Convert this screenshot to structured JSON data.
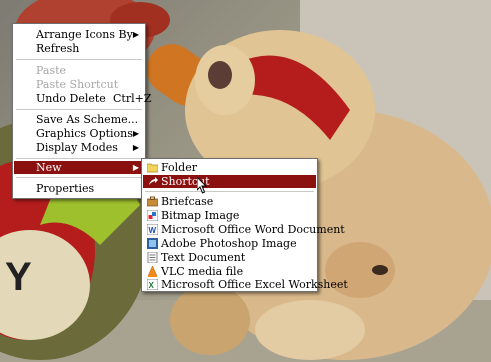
{
  "context_menu": {
    "items": [
      {
        "label": "Arrange Icons By",
        "submenu": true
      },
      {
        "label": "Refresh"
      },
      {
        "label": "Paste",
        "disabled": true
      },
      {
        "label": "Paste Shortcut",
        "disabled": true
      },
      {
        "label": "Undo Delete",
        "shortcut": "Ctrl+Z"
      },
      {
        "label": "Save As Scheme..."
      },
      {
        "label": "Graphics Options",
        "submenu": true
      },
      {
        "label": "Display Modes",
        "submenu": true
      },
      {
        "label": "New",
        "submenu": true,
        "highlighted": true
      },
      {
        "label": "Properties"
      }
    ]
  },
  "new_submenu": {
    "items": [
      {
        "label": "Folder",
        "icon": "folder-icon"
      },
      {
        "label": "Shortcut",
        "icon": "shortcut-icon",
        "highlighted": true
      },
      {
        "label": "Briefcase",
        "icon": "briefcase-icon"
      },
      {
        "label": "Bitmap Image",
        "icon": "bitmap-icon"
      },
      {
        "label": "Microsoft Office Word Document",
        "icon": "word-document-icon"
      },
      {
        "label": "Adobe Photoshop Image",
        "icon": "photoshop-icon"
      },
      {
        "label": "Text Document",
        "icon": "text-document-icon"
      },
      {
        "label": "VLC media file",
        "icon": "vlc-icon"
      },
      {
        "label": "Microsoft Office Excel Worksheet",
        "icon": "excel-worksheet-icon"
      }
    ]
  },
  "colors": {
    "highlight": "#8b1010",
    "wallpaper_red": "#b51d1d"
  }
}
